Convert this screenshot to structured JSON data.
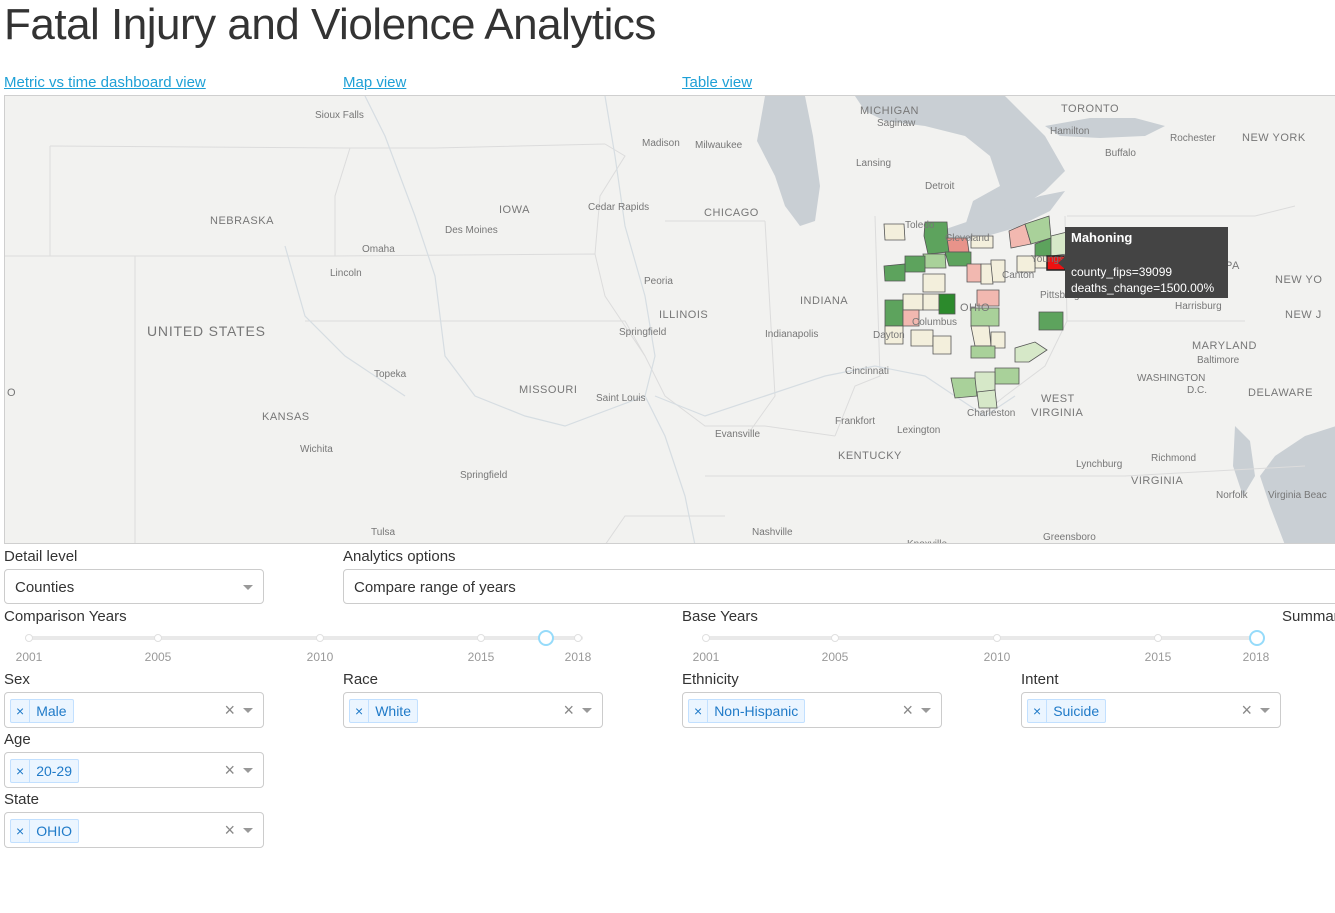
{
  "title": "Fatal Injury and Violence Analytics",
  "nav": {
    "dashboard": "Metric vs time dashboard view",
    "map": "Map view",
    "table": "Table view"
  },
  "map": {
    "places": [
      {
        "name": "MICHIGAN",
        "cls": "region"
      },
      {
        "name": "TORONTO",
        "cls": "region"
      },
      {
        "name": "Saginaw",
        "cls": "city"
      },
      {
        "name": "Sioux Falls",
        "cls": "city"
      },
      {
        "name": "Madison",
        "cls": "city"
      },
      {
        "name": "Milwaukee",
        "cls": "city"
      },
      {
        "name": "Hamilton",
        "cls": "city"
      },
      {
        "name": "Rochester",
        "cls": "city"
      },
      {
        "name": "NEW YORK",
        "cls": "region"
      },
      {
        "name": "Buffalo",
        "cls": "city"
      },
      {
        "name": "Lansing",
        "cls": "city"
      },
      {
        "name": "Detroit",
        "cls": "city"
      },
      {
        "name": "NEBRASKA",
        "cls": "region"
      },
      {
        "name": "IOWA",
        "cls": "region"
      },
      {
        "name": "Cedar Rapids",
        "cls": "city"
      },
      {
        "name": "CHICAGO",
        "cls": "region"
      },
      {
        "name": "Des Moines",
        "cls": "city"
      },
      {
        "name": "Omaha",
        "cls": "city"
      },
      {
        "name": "Lincoln",
        "cls": "city"
      },
      {
        "name": "Peoria",
        "cls": "city"
      },
      {
        "name": "ILLINOIS",
        "cls": "region"
      },
      {
        "name": "INDIANA",
        "cls": "region"
      },
      {
        "name": "UNITED STATES",
        "cls": "country"
      },
      {
        "name": "Springfield",
        "cls": "city"
      },
      {
        "name": "Indianapolis",
        "cls": "city"
      },
      {
        "name": "Pittsburgh",
        "cls": "city"
      },
      {
        "name": "Harrisburg",
        "cls": "city"
      },
      {
        "name": "NEW YO",
        "cls": "region"
      },
      {
        "name": "NEW J",
        "cls": "region"
      },
      {
        "name": "MARYLAND",
        "cls": "region"
      },
      {
        "name": "Baltimore",
        "cls": "city"
      },
      {
        "name": "WASHINGTON",
        "cls": "city"
      },
      {
        "name": "D.C.",
        "cls": "city"
      },
      {
        "name": "DELAWARE",
        "cls": "region"
      },
      {
        "name": "Topeka",
        "cls": "city"
      },
      {
        "name": "MISSOURI",
        "cls": "region"
      },
      {
        "name": "Cincinnati",
        "cls": "city"
      },
      {
        "name": "Saint Louis",
        "cls": "city"
      },
      {
        "name": "WEST",
        "cls": "region"
      },
      {
        "name": "VIRGINIA",
        "cls": "region"
      },
      {
        "name": "KANSAS",
        "cls": "region"
      },
      {
        "name": "Charleston",
        "cls": "city"
      },
      {
        "name": "Wichita",
        "cls": "city"
      },
      {
        "name": "Evansville",
        "cls": "city"
      },
      {
        "name": "Frankfort",
        "cls": "city"
      },
      {
        "name": "Lexington",
        "cls": "city"
      },
      {
        "name": "KENTUCKY",
        "cls": "region"
      },
      {
        "name": "Springfield",
        "cls": "city"
      },
      {
        "name": "Lynchburg",
        "cls": "city"
      },
      {
        "name": "Richmond",
        "cls": "city"
      },
      {
        "name": "VIRGINIA",
        "cls": "region"
      },
      {
        "name": "Norfolk",
        "cls": "city"
      },
      {
        "name": "Virginia Beac",
        "cls": "city"
      },
      {
        "name": "Tulsa",
        "cls": "city"
      },
      {
        "name": "Nashville",
        "cls": "city"
      },
      {
        "name": "Greensboro",
        "cls": "city"
      },
      {
        "name": "Knoxville",
        "cls": "city"
      },
      {
        "name": "Dayton",
        "cls": "city"
      },
      {
        "name": "Columbus",
        "cls": "city"
      },
      {
        "name": "Youngstown",
        "cls": "city"
      },
      {
        "name": "Canton",
        "cls": "city"
      },
      {
        "name": "Cleveland",
        "cls": "city"
      },
      {
        "name": "Toledo",
        "cls": "city"
      },
      {
        "name": "OHIO",
        "cls": "region"
      },
      {
        "name": "PA",
        "cls": "region"
      },
      {
        "name": "O",
        "cls": "region"
      }
    ],
    "colors": {
      "water": "#c9cfd4",
      "land": "#f2f2f0",
      "strong_green": "#2c8a2c",
      "green": "#5da35d",
      "light_green": "#a9d19a",
      "pale_green": "#d6e8c8",
      "neutral": "#f3efdc",
      "light_red": "#f2b8b0",
      "red": "#e8938a",
      "highlight": "#ee1111"
    }
  },
  "tooltip": {
    "title": "Mahoning",
    "fips": "county_fips=39099",
    "change": "deaths_change=1500.00%"
  },
  "controls": {
    "detail_level": {
      "label": "Detail level",
      "value": "Counties"
    },
    "analytics": {
      "label": "Analytics options",
      "value": "Compare range of years"
    },
    "comparison_years": {
      "label": "Comparison Years",
      "marks": [
        "2001",
        "2005",
        "2010",
        "2015",
        "2018"
      ],
      "selected": 2017
    },
    "base_years": {
      "label": "Base Years",
      "marks": [
        "2001",
        "2005",
        "2010",
        "2015",
        "2018"
      ],
      "selected": 2018
    },
    "summary_label": "Summar",
    "sex": {
      "label": "Sex",
      "value": "Male"
    },
    "race": {
      "label": "Race",
      "value": "White"
    },
    "ethnicity": {
      "label": "Ethnicity",
      "value": "Non-Hispanic"
    },
    "intent": {
      "label": "Intent",
      "value": "Suicide"
    },
    "age": {
      "label": "Age",
      "value": "20-29"
    },
    "state": {
      "label": "State",
      "value": "OHIO"
    },
    "clear_glyph": "×",
    "remove_glyph": "×"
  }
}
